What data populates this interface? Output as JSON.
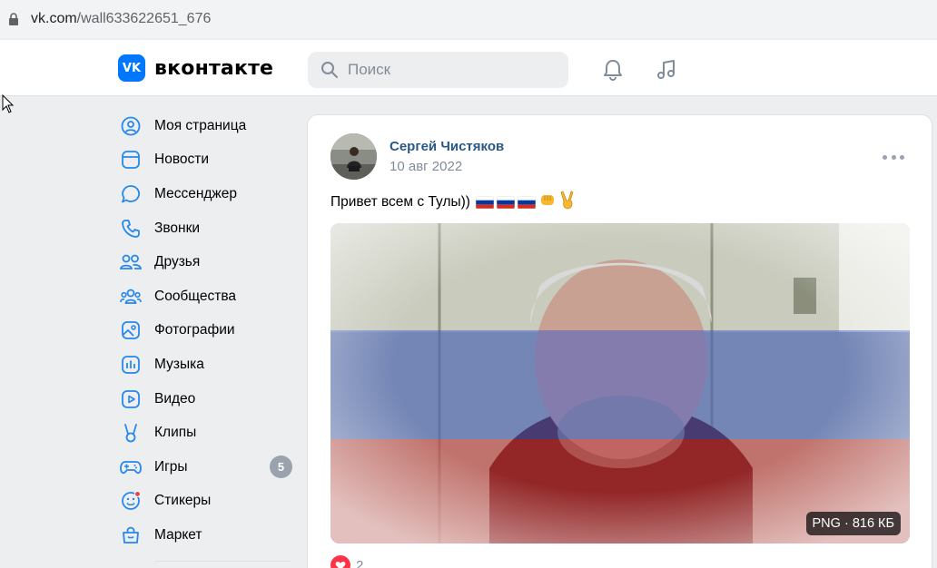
{
  "browser": {
    "url_host": "vk.com",
    "url_path": "/wall633622651_676"
  },
  "header": {
    "logo_mark": "VK",
    "logo_text": "вконтакте",
    "search_placeholder": "Поиск",
    "icons": [
      "bell-icon",
      "music-icon"
    ],
    "accent_color": "#0077ff"
  },
  "sidebar": {
    "items": [
      {
        "label": "Моя страница",
        "icon": "user-circle-icon"
      },
      {
        "label": "Новости",
        "icon": "news-icon"
      },
      {
        "label": "Мессенджер",
        "icon": "message-icon"
      },
      {
        "label": "Звонки",
        "icon": "phone-icon"
      },
      {
        "label": "Друзья",
        "icon": "friends-icon"
      },
      {
        "label": "Сообщества",
        "icon": "communities-icon"
      },
      {
        "label": "Фотографии",
        "icon": "photo-icon"
      },
      {
        "label": "Музыка",
        "icon": "music-icon"
      },
      {
        "label": "Видео",
        "icon": "video-icon"
      },
      {
        "label": "Клипы",
        "icon": "clips-icon"
      },
      {
        "label": "Игры",
        "icon": "games-icon",
        "badge": "5"
      },
      {
        "label": "Стикеры",
        "icon": "stickers-icon"
      },
      {
        "label": "Маркет",
        "icon": "market-icon"
      }
    ]
  },
  "post": {
    "author": "Сергей Чистяков",
    "date": "10 авг 2022",
    "text": "Привет всем с Тулы))",
    "emojis": [
      "russian-flag",
      "russian-flag",
      "russian-flag",
      "fist-bump",
      "victory-hand"
    ],
    "attachment": {
      "format": "PNG",
      "size": "816 КБ"
    },
    "likes_count": "2"
  }
}
